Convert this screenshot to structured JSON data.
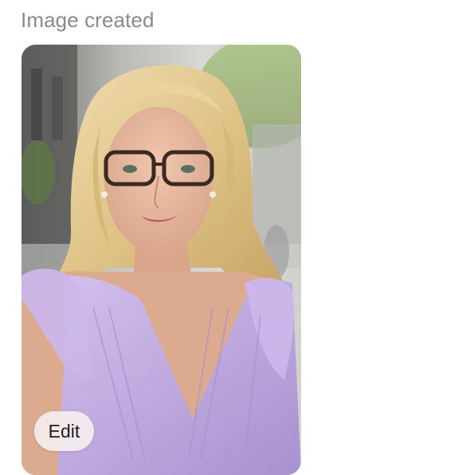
{
  "header": {
    "status_text": "Image created"
  },
  "image": {
    "subject": "photo-portrait"
  },
  "actions": {
    "edit_label": "Edit"
  },
  "colors": {
    "status_text": "#8a8a8a",
    "dress": "#c3aee0",
    "hair": "#e2c98d",
    "edit_button_bg": "#f5eeee"
  }
}
